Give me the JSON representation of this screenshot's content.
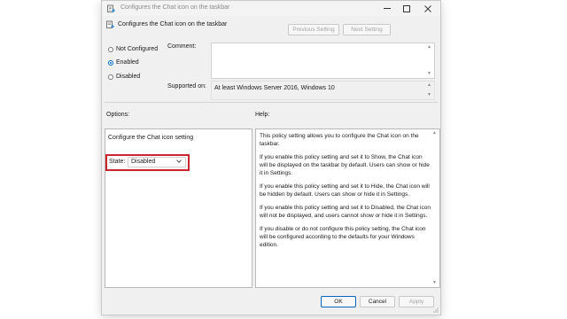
{
  "window": {
    "title": "Configures the Chat icon on the taskbar",
    "header_title": "Configures the Chat icon on the taskbar"
  },
  "nav": {
    "previous_label": "Previous Setting",
    "next_label": "Next Setting"
  },
  "state_radios": [
    {
      "label": "Not Configured",
      "checked": false
    },
    {
      "label": "Enabled",
      "checked": true
    },
    {
      "label": "Disabled",
      "checked": false
    }
  ],
  "comment": {
    "label": "Comment:",
    "value": ""
  },
  "supported": {
    "label": "Supported on:",
    "value": "At least Windows Server 2016, Windows 10"
  },
  "options": {
    "label": "Options:",
    "setting_title": "Configure the Chat icon setting",
    "state_label": "State:",
    "state_value": "Disabled"
  },
  "help": {
    "label": "Help:",
    "paragraphs": [
      "This policy setting allows you to configure the Chat icon on the taskbar.",
      "If you enable this policy setting and set it to Show, the Chat icon will be displayed on the taskbar by default. Users can show or hide it in Settings.",
      "If you enable this policy setting and set it to Hide, the Chat icon will be hidden by default. Users can show or hide it in Settings.",
      "If you enable this policy setting and set it to Disabled, the Chat icon will not be displayed, and users cannot show or hide it in Settings.",
      "If you disable or do not configure this policy setting, the Chat icon will be configured according to the defaults for your Windows edition."
    ]
  },
  "buttons": {
    "ok": "OK",
    "cancel": "Cancel",
    "apply": "Apply"
  },
  "colors": {
    "accent": "#0067c0",
    "highlight": "#c8252c"
  }
}
